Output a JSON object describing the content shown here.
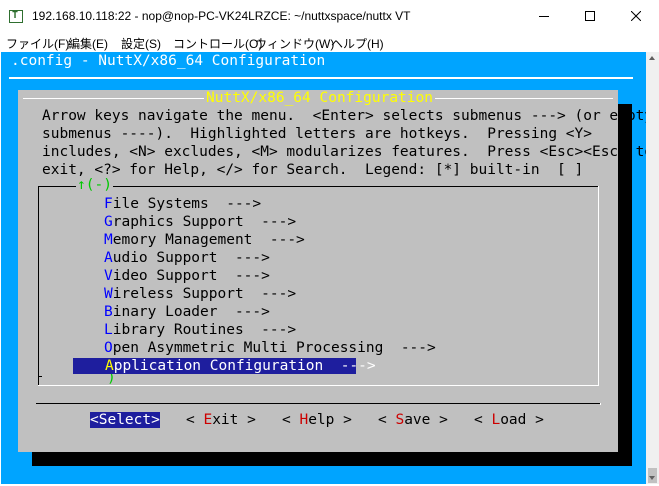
{
  "window": {
    "title": "192.168.10.118:22 - nop@nop-PC-VK24LRZCE: ~/nuttxspace/nuttx VT",
    "app_icon_letter": "T",
    "controls": [
      "minimize-icon",
      "maximize-icon",
      "close-icon"
    ]
  },
  "menubar": {
    "items": [
      "ファイル(F)",
      "編集(E)",
      "設定(S)",
      "コントロール(O)",
      "ウィンドウ(W)",
      "ヘルプ(H)"
    ]
  },
  "terminal": {
    "background": "#00a4ff",
    "header": ".config - NuttX/x86_64 Configuration",
    "dialog": {
      "title": "NuttX/x86_64 Configuration",
      "help_lines": [
        "Arrow keys navigate the menu.  <Enter> selects submenus ---> (or empty",
        "submenus ----).  Highlighted letters are hotkeys.  Pressing <Y>",
        "includes, <N> excludes, <M> modularizes features.  Press <Esc><Esc> to",
        "exit, <?> for Help, </> for Search.  Legend: [*] built-in  [ ]"
      ],
      "scroll_up_indicator": "↑(-)",
      "scroll_down_indicator": ")",
      "menu_items": [
        {
          "hotkey": "F",
          "rest": "ile Systems  --->"
        },
        {
          "hotkey": "G",
          "rest": "raphics Support  --->"
        },
        {
          "hotkey": "M",
          "rest": "emory Management  --->"
        },
        {
          "hotkey": "A",
          "rest": "udio Support  --->"
        },
        {
          "hotkey": "V",
          "rest": "ideo Support  --->"
        },
        {
          "hotkey": "W",
          "rest": "ireless Support  --->"
        },
        {
          "hotkey": "B",
          "rest": "inary Loader  --->"
        },
        {
          "hotkey": "L",
          "rest": "ibrary Routines  --->"
        },
        {
          "hotkey": "O",
          "rest": "pen Asymmetric Multi Processing  --->"
        },
        {
          "hotkey": "A",
          "rest": "pplication Configuration  --->"
        }
      ],
      "selected_index": 9,
      "buttons": {
        "select": "<Select>",
        "exit": {
          "pre": "< ",
          "hotkey": "E",
          "post": "xit >"
        },
        "help": {
          "pre": "< ",
          "hotkey": "H",
          "post": "elp >"
        },
        "save": {
          "pre": "< ",
          "hotkey": "S",
          "post": "ave >"
        },
        "load": {
          "pre": "< ",
          "hotkey": "L",
          "post": "oad >"
        }
      }
    }
  }
}
